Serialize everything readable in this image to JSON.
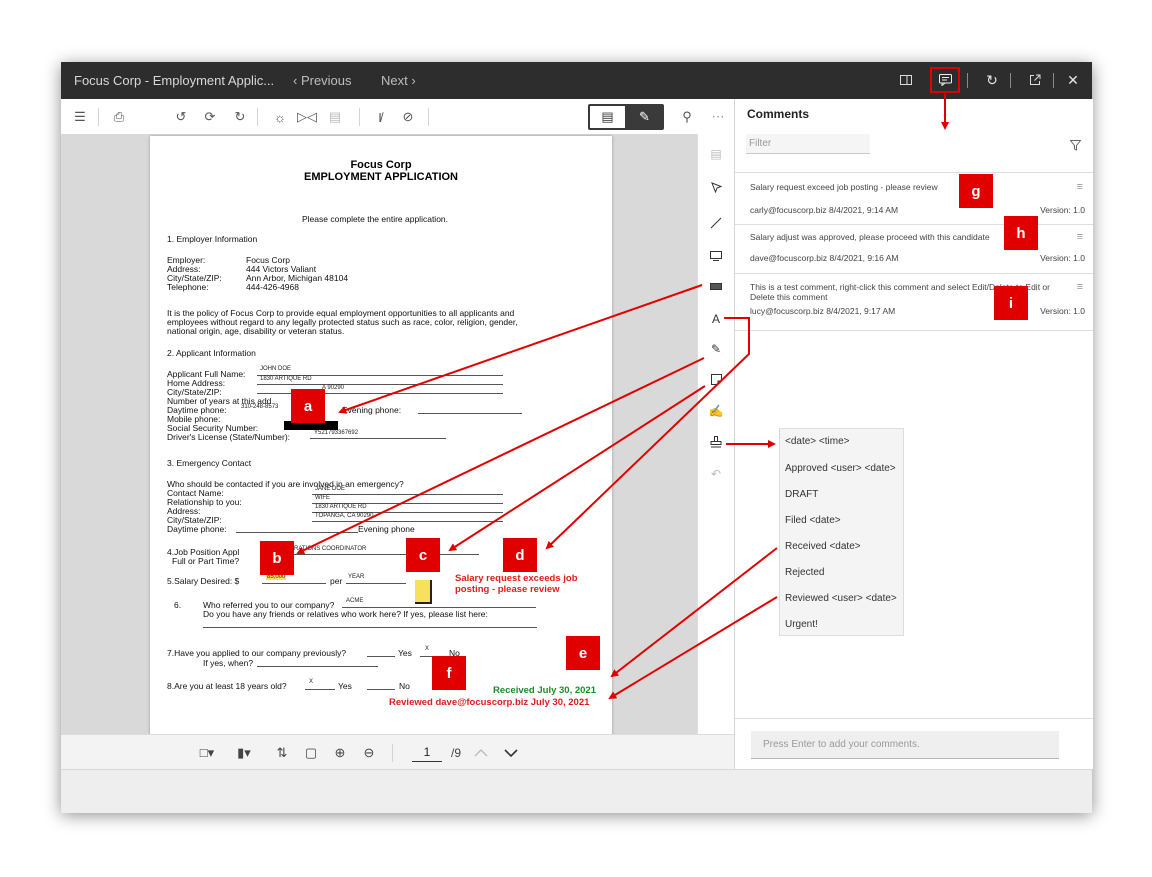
{
  "window": {
    "title": "Focus Corp - Employment Applic...",
    "prev": "‹ Previous",
    "next": "Next ›"
  },
  "viewer": {
    "page_current": "1",
    "page_total": "/9"
  },
  "document": {
    "company": "Focus Corp",
    "heading": "EMPLOYMENT APPLICATION",
    "instruction": "Please complete the entire application.",
    "sec1": "1.      Employer Information",
    "employer_lbl": "Employer:",
    "employer_val": "Focus Corp",
    "address_lbl": "Address:",
    "address_val": "444 Victors Valiant",
    "city_lbl": "City/State/ZIP:",
    "city_val": "Ann Arbor, Michigan 48104",
    "tel_lbl": "Telephone:",
    "tel_val": "444-426-4968",
    "policy1": "It is the policy of Focus Corp to provide equal employment opportunities to all applicants and",
    "policy2": "employees without regard to any legally protected status such as race, color, religion, gender,",
    "policy3": "national origin, age, disability or veteran status.",
    "sec2": "2.      Applicant Information",
    "a_name_lbl": "Applicant Full Name:",
    "a_name_val": "JOHN DOE",
    "a_home_lbl": "Home Address:",
    "a_home_val": "1830 ARTIQUE RD",
    "a_city_lbl": "City/State/ZIP:",
    "a_city_val": "A 90290",
    "a_years_lbl": "Number of years at this add",
    "a_day_lbl": "Daytime phone:",
    "a_day_val": "310-248-8573",
    "a_even_lbl": "Evening phone:",
    "a_mobile_lbl": "Mobile phone:",
    "a_ssn_lbl": "Social Security Number:",
    "a_dl_lbl": "Driver's License (State/Number):",
    "a_dl_val": "Y521793367692",
    "sec3": "3.      Emergency Contact",
    "e_q": "Who should be contacted if you are involved in an emergency?",
    "e_name_lbl": "Contact Name:",
    "e_name_val": "JANE DOE",
    "e_rel_lbl": "Relationship to you:",
    "e_rel_val": "WIFE",
    "e_addr_lbl": "Address:",
    "e_addr_val": "1830 ARTIQUE RD",
    "e_city_lbl": "City/State/ZIP:",
    "e_city_val": "TOPANGA, CA 90290",
    "e_day_lbl": "Daytime phone:",
    "e_even_lbl": "Evening phone",
    "q4_lbl": "4.Job Position Appl",
    "q4_val": "ERATIONS COORDINATOR",
    "q4_b": "Full or Part Time?",
    "q5_lbl": "5.Salary Desired:   $",
    "q5_val": "85,000",
    "q5_per": "per",
    "q5_year": "YEAR",
    "q6_lbl": "6.",
    "q6_text": "Who referred you to our company?",
    "q6_val": "ACME",
    "q6_b": "Do you have any friends or relatives who work here? If yes, please list here:",
    "q7": "7.Have you applied to our company previously?",
    "q7_yes": "Yes",
    "q7_x": "X",
    "q7_no": "No",
    "q7_b": "If yes, when?",
    "q8": "8.Are you at least 18 years old?",
    "q8_x": "X",
    "q8_yes": "Yes",
    "q8_no": "No",
    "note_line1": "Salary request exceeds job",
    "note_line2": "posting - please review",
    "stamp_received": "Received July 30, 2021",
    "stamp_reviewed": "Reviewed dave@focuscorp.biz July 30, 2021"
  },
  "comments": {
    "title": "Comments",
    "filter_placeholder": "Filter",
    "input_placeholder": "Press Enter to add your comments.",
    "items": [
      {
        "text": "Salary request exceed job posting - please review",
        "author": "carly@focuscorp.biz",
        "time": "8/4/2021, 9:14 AM",
        "version": "Version: 1.0"
      },
      {
        "text": "Salary adjust was approved, please proceed with this candidate",
        "author": "dave@focuscorp.biz",
        "time": "8/4/2021, 9:16 AM",
        "version": "Version: 1.0"
      },
      {
        "text": "This is a test comment, right-click this comment and select Edit/Delete to Edit or Delete this comment",
        "author": "lucy@focuscorp.biz",
        "time": "8/4/2021, 9:17 AM",
        "version": "Version: 1.0"
      }
    ]
  },
  "stamp_menu": [
    "<date> <time>",
    "Approved <user> <date>",
    "DRAFT",
    "Filed <date>",
    "Received <date>",
    "Rejected",
    "Reviewed <user> <date>",
    "Urgent!"
  ],
  "callouts": [
    "a",
    "b",
    "c",
    "d",
    "e",
    "f",
    "g",
    "h",
    "i"
  ],
  "colors": {
    "callout": "#e00000",
    "titlebar": "#2d2d2d",
    "stamp_red": "#e11c1c",
    "stamp_green": "#1e8b2a",
    "note": "#f6e25a"
  }
}
